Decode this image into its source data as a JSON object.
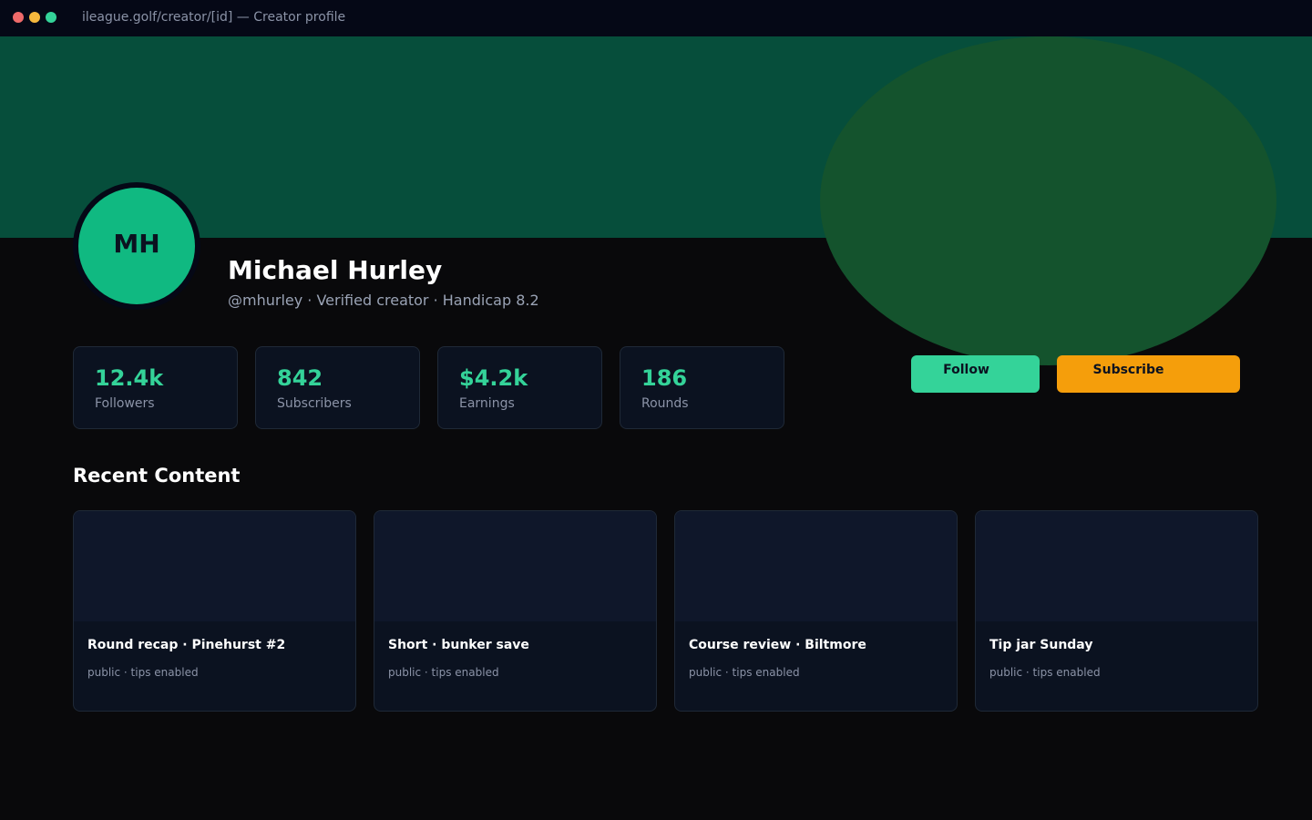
{
  "window": {
    "url_title": "ileague.golf/creator/[id] — Creator profile"
  },
  "profile": {
    "initials": "MH",
    "name": "Michael Hurley",
    "subline": "@mhurley · Verified creator · Handicap 8.2"
  },
  "stats": [
    {
      "value": "12.4k",
      "label": "Followers"
    },
    {
      "value": "842",
      "label": "Subscribers"
    },
    {
      "value": "$4.2k",
      "label": "Earnings"
    },
    {
      "value": "186",
      "label": "Rounds"
    }
  ],
  "actions": {
    "follow_label": "Follow",
    "subscribe_label": "Subscribe"
  },
  "content": {
    "section_title": "Recent Content",
    "cards": [
      {
        "title": "Round recap · Pinehurst #2",
        "meta": "public · tips enabled"
      },
      {
        "title": "Short · bunker save",
        "meta": "public · tips enabled"
      },
      {
        "title": "Course review · Biltmore",
        "meta": "public · tips enabled"
      },
      {
        "title": "Tip jar Sunday",
        "meta": "public · tips enabled"
      }
    ]
  },
  "colors": {
    "accent": "#34d399",
    "subscribe": "#f59e0b",
    "banner": "#064e3b",
    "banner_blob": "#14532d",
    "background": "#09090b"
  }
}
